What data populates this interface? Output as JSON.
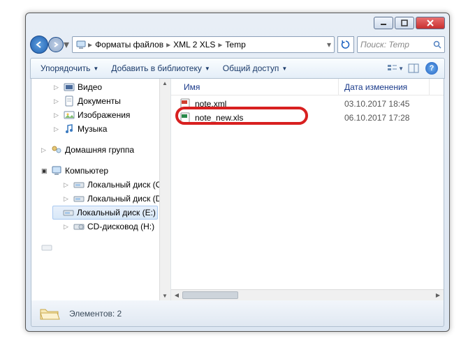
{
  "breadcrumb": {
    "items": [
      "Форматы файлов",
      "XML 2 XLS",
      "Temp"
    ]
  },
  "search": {
    "placeholder": "Поиск: Temp"
  },
  "toolbar": {
    "organize": "Упорядочить",
    "library": "Добавить в библиотеку",
    "share": "Общий доступ"
  },
  "sidebar": {
    "libraries": [
      {
        "label": "Видео"
      },
      {
        "label": "Документы"
      },
      {
        "label": "Изображения"
      },
      {
        "label": "Музыка"
      }
    ],
    "homegroup": "Домашняя группа",
    "computer": {
      "label": "Компьютер",
      "drives": [
        {
          "label": "Локальный диск (C:)"
        },
        {
          "label": "Локальный диск (D:)"
        },
        {
          "label": "Локальный диск (E:)",
          "selected": true
        },
        {
          "label": "CD-дисковод (H:)"
        }
      ]
    }
  },
  "columns": {
    "name": "Имя",
    "date": "Дата изменения"
  },
  "files": [
    {
      "name": "note.xml",
      "date": "03.10.2017 18:45",
      "type": "xml"
    },
    {
      "name": "note_new.xls",
      "date": "06.10.2017 17:28",
      "type": "xls",
      "highlighted": true
    }
  ],
  "status": {
    "label": "Элементов: 2"
  }
}
